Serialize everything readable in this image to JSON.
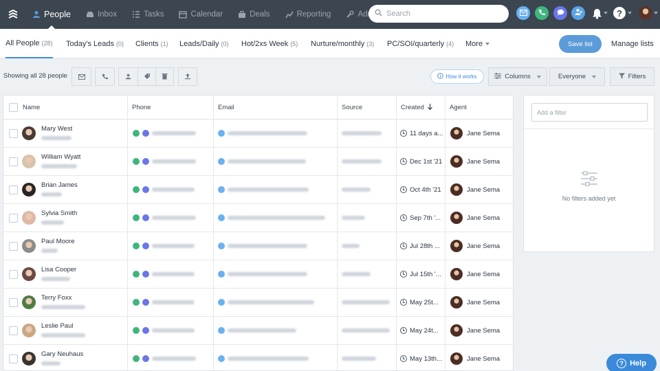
{
  "colors": {
    "nav_bg": "#3c4651",
    "accent": "#3b8ad9",
    "call_green": "#3fb57d",
    "sms_purple": "#6b77e8"
  },
  "topnav": {
    "items": [
      {
        "label": "People",
        "icon": "person-icon"
      },
      {
        "label": "Inbox",
        "icon": "inbox-icon"
      },
      {
        "label": "Tasks",
        "icon": "tasks-icon"
      },
      {
        "label": "Calendar",
        "icon": "calendar-icon"
      },
      {
        "label": "Deals",
        "icon": "deals-icon"
      },
      {
        "label": "Reporting",
        "icon": "reporting-icon"
      },
      {
        "label": "Admin",
        "icon": "wrench-icon"
      }
    ],
    "search_placeholder": "Search"
  },
  "lists": {
    "tabs": [
      {
        "label": "All People",
        "count": "(28)"
      },
      {
        "label": "Today's Leads",
        "count": "(0)"
      },
      {
        "label": "Clients",
        "count": "(1)"
      },
      {
        "label": "Leads/Daily",
        "count": "(0)"
      },
      {
        "label": "Hot/2xs Week",
        "count": "(5)"
      },
      {
        "label": "Nurture/monthly",
        "count": "(3)"
      },
      {
        "label": "PC/SOI/quarterly",
        "count": "(4)"
      }
    ],
    "more_label": "More",
    "save_label": "Save list",
    "manage_label": "Manage lists"
  },
  "toolbar": {
    "showing": "Showing all 28 people",
    "how_it_works": "How it works",
    "columns": "Columns",
    "everyone": "Everyone",
    "filters": "Filters"
  },
  "table": {
    "headers": {
      "name": "Name",
      "phone": "Phone",
      "email": "Email",
      "source": "Source",
      "created": "Created",
      "agent": "Agent"
    },
    "rows": [
      {
        "name": "Mary West",
        "created": "11 days a...",
        "agent": "Jane Sema"
      },
      {
        "name": "William Wyatt",
        "created": "Dec 1st '21",
        "agent": "Jane Sema"
      },
      {
        "name": "Brian James",
        "created": "Oct 4th '21",
        "agent": "Jane Sema"
      },
      {
        "name": "Sylvia Smith",
        "created": "Sep 7th '...",
        "agent": "Jane Sema"
      },
      {
        "name": "Paul Moore",
        "created": "Jul 28th ...",
        "agent": "Jane Sema"
      },
      {
        "name": "Lisa Cooper",
        "created": "Jul 15th '...",
        "agent": "Jane Sema"
      },
      {
        "name": "Terry Foxx",
        "created": "May 25t...",
        "agent": "Jane Sema"
      },
      {
        "name": "Leslie Paul",
        "created": "May 24t...",
        "agent": "Jane Sema"
      },
      {
        "name": "Gary Neuhaus",
        "created": "May 13th...",
        "agent": "Jane Sema"
      }
    ]
  },
  "filter_panel": {
    "placeholder": "Add a filter",
    "empty": "No filters added yet"
  },
  "help": {
    "label": "Help"
  }
}
